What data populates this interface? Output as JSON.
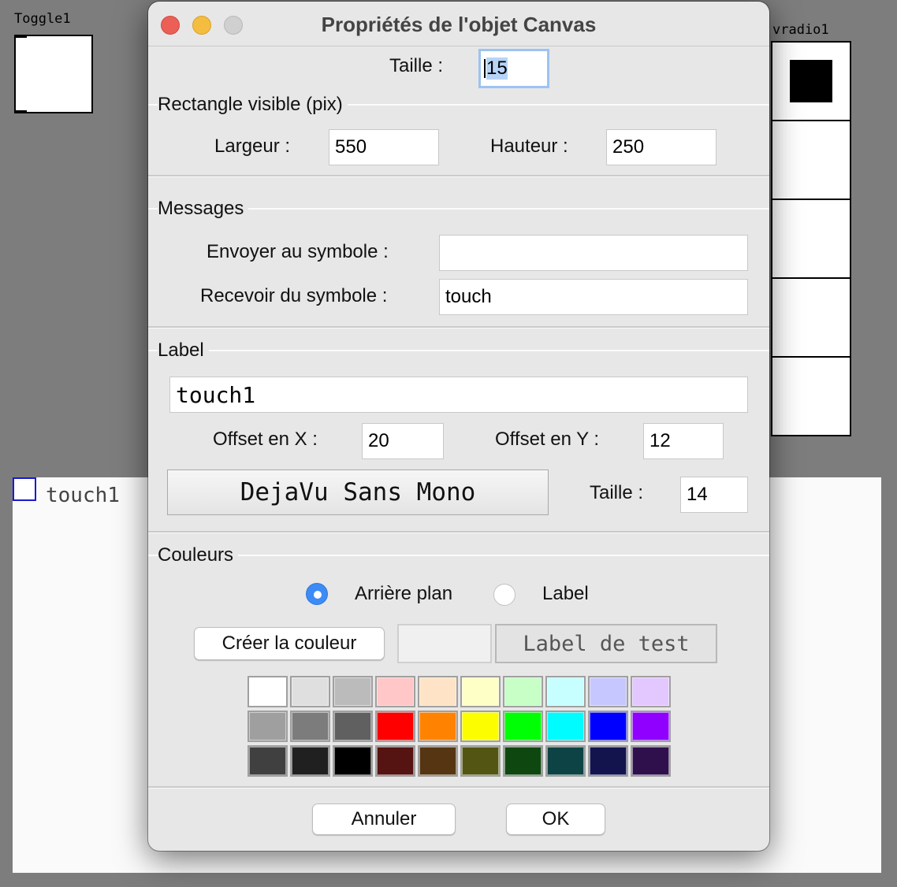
{
  "background": {
    "toggle_label": "Toggle1",
    "vradio_label": "vradio1",
    "canvas_label": "touch1"
  },
  "dialog": {
    "title": "Propriétés de l'objet Canvas",
    "size_label": "Taille :",
    "size_value": "15",
    "visible_rect": {
      "title": "Rectangle visible (pix)",
      "width_label": "Largeur :",
      "width_value": "550",
      "height_label": "Hauteur :",
      "height_value": "250"
    },
    "messages": {
      "title": "Messages",
      "send_label": "Envoyer au symbole :",
      "send_value": "",
      "receive_label": "Recevoir du symbole :",
      "receive_value": "touch"
    },
    "label": {
      "title": "Label",
      "value": "touch1",
      "offset_x_label": "Offset en X :",
      "offset_x_value": "20",
      "offset_y_label": "Offset en Y :",
      "offset_y_value": "12",
      "font_button": "DejaVu Sans Mono",
      "font_size_label": "Taille :",
      "font_size_value": "14"
    },
    "colors": {
      "title": "Couleurs",
      "radio_background": "Arrière plan",
      "radio_label": "Label",
      "selected": "Arrière plan",
      "create_button": "Créer la couleur",
      "test_label": "Label de test",
      "preview_color": "#f0f0f0",
      "palette": [
        [
          "#ffffff",
          "#dfdfdf",
          "#bbbbbb",
          "#ffc7c7",
          "#ffe3c6",
          "#feffc7",
          "#c7ffc7",
          "#c7feff",
          "#c7c7ff",
          "#e3c7ff"
        ],
        [
          "#9f9f9f",
          "#7c7c7c",
          "#606060",
          "#ff0000",
          "#ff8300",
          "#fcfe00",
          "#00ff04",
          "#00fcff",
          "#0000ff",
          "#8f00ff"
        ],
        [
          "#404040",
          "#202020",
          "#000000",
          "#551312",
          "#553512",
          "#535512",
          "#0f4710",
          "#0e4345",
          "#13144d",
          "#2f104d"
        ]
      ]
    },
    "buttons": {
      "cancel": "Annuler",
      "ok": "OK"
    }
  }
}
